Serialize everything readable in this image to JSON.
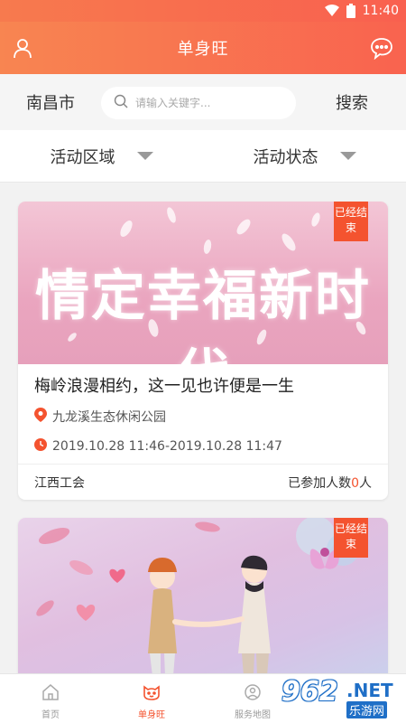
{
  "status_bar": {
    "time": "11:40",
    "icons": [
      "wifi-icon",
      "battery-icon"
    ]
  },
  "header": {
    "title": "单身旺",
    "left_icon": "user-icon",
    "right_icon": "chat-icon"
  },
  "search": {
    "city": "南昌市",
    "placeholder": "请输入关键字...",
    "button": "搜索"
  },
  "filters": [
    {
      "label": "活动区域"
    },
    {
      "label": "活动状态"
    }
  ],
  "cards": [
    {
      "banner_text": "情定幸福新时代",
      "badge": "已经结束",
      "title": "梅岭浪漫相约，这一见也许便是一生",
      "location": "九龙溪生态休闲公园",
      "time": "2019.10.28 11:46-2019.10.28 11:47",
      "organizer": "江西工会",
      "joined_prefix": "已参加人数",
      "joined_count": "0",
      "joined_suffix": "人"
    },
    {
      "badge": "已经结束"
    }
  ],
  "tabs": [
    {
      "label": "首页",
      "icon": "home-icon",
      "active": false
    },
    {
      "label": "单身旺",
      "icon": "cat-face-icon",
      "active": true
    },
    {
      "label": "服务地图",
      "icon": "map-icon",
      "active": false
    }
  ],
  "watermark": {
    "number": "962",
    "suffix": ".NET",
    "sub": "乐游网"
  },
  "colors": {
    "accent": "#f4532f",
    "header_start": "#f88551",
    "header_end": "#f9634f"
  }
}
